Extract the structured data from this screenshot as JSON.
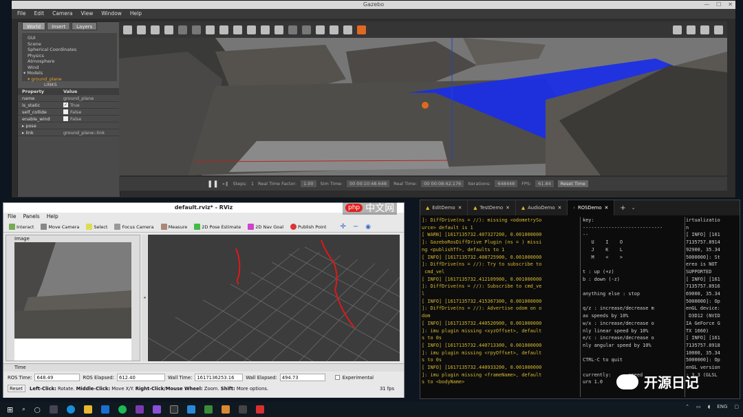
{
  "gazebo": {
    "title": "Gazebo",
    "menu": [
      "File",
      "Edit",
      "Camera",
      "View",
      "Window",
      "Help"
    ],
    "tabs": [
      "World",
      "Insert",
      "Layers"
    ],
    "tree": [
      "GUI",
      "Scene",
      "Spherical Coordinates",
      "Physics",
      "Atmosphere",
      "Wind",
      "▾ Models",
      "▾ ground_plane",
      "LINKS"
    ],
    "prop_header": {
      "property": "Property",
      "value": "Value"
    },
    "props": [
      {
        "k": "name",
        "v": "ground_plane"
      },
      {
        "k": "is_static",
        "v": "True",
        "checked": true
      },
      {
        "k": "self_collide",
        "v": "False",
        "checked": false
      },
      {
        "k": "enable_wind",
        "v": "False",
        "checked": false
      },
      {
        "k": "▸ pose",
        "v": ""
      },
      {
        "k": "▸ link",
        "v": "ground_plane::link"
      }
    ],
    "bottom": {
      "steps_label": "Steps:",
      "steps": "1",
      "rtf_label": "Real Time Factor:",
      "rtf": "1.00",
      "sim_label": "Sim Time:",
      "sim": "00 00:10:48.648",
      "real_label": "Real Time:",
      "real": "00 00:08:42.176",
      "iter_label": "Iterations:",
      "iter": "648448",
      "fps_label": "FPS:",
      "fps": "61.84",
      "reset": "Reset Time"
    }
  },
  "rviz": {
    "title": "default.rviz* - RViz",
    "menu": [
      "File",
      "Panels",
      "Help"
    ],
    "tools": [
      "Interact",
      "Move Camera",
      "Select",
      "Focus Camera",
      "Measure",
      "2D Pose Estimate",
      "2D Nav Goal",
      "Publish Point"
    ],
    "image_panel": "Image",
    "time_panel": "Time",
    "ros_time_label": "ROS Time:",
    "ros_time": "648.49",
    "ros_elapsed_label": "ROS Elapsed:",
    "ros_elapsed": "612.40",
    "wall_time_label": "Wall Time:",
    "wall_time": "1617136253.16",
    "wall_elapsed_label": "Wall Elapsed:",
    "wall_elapsed": "494.73",
    "experimental": "Experimental",
    "reset": "Reset",
    "hint_b1": "Left-Click:",
    "hint_t1": " Rotate. ",
    "hint_b2": "Middle-Click:",
    "hint_t2": " Move X/Y. ",
    "hint_b3": "Right-Click/Mouse Wheel:",
    "hint_t3": " Zoom. ",
    "hint_b4": "Shift:",
    "hint_t4": " More options.",
    "fps": "31 fps"
  },
  "terminal": {
    "tabs": [
      "EditDemo",
      "TestDemo",
      "AudioDemo",
      "ROSDemo"
    ],
    "pane1": "]: DiffDrive(ns = //): missing <odometrySo\nurce> default is 1\n[ WARN] [1617135732.407327200, 0.001000000\n]: GazeboRosDiffDrive Plugin (ns = ) missi\nng <publishTf>, defaults to 1\n[ INFO] [1617135732.408725900, 0.001000000\n]: DiffDrive(ns = //): Try to subscribe to\n cmd_vel\n[ INFO] [1617135732.412109900, 0.001000000\n]: DiffDrive(ns = //): Subscribe to cmd_ve\nl\n[ INFO] [1617135732.415367300, 0.001000000\n]: DiffDrive(ns = //): Advertise odom on o\ndom\n[ INFO] [1617135732.440520900, 0.001000000\n]: imu plugin missing <xyzOffset>, default\ns to 0s\n[ INFO] [1617135732.440713300, 0.001000000\n]: imu plugin missing <rpyOffset>, default\ns to 0s\n[ INFO] [1617135732.440933200, 0.001000000\n]: imu plugin missing <frameName>, default\ns to <bodyName>",
    "pane2": "key:\n----------------------------\n--\n   U    I    O\n   J    K    L\n   M    <    >\n\nt : up (+z)\nb : down (-z)\n\nanything else : stop\n\nq/z : increase/decrease m\nax speeds by 10%\nw/x : increase/decrease o\nnly linear speed by 10%\ne/c : increase/decrease o\nnly angular speed by 10%\n\nCTRL-C to quit\n\ncurrently:      speed\nurn 1.0",
    "pane3": "irtualizatio\nn\n[ INFO] [161\n7135757.8914\n92900, 35.34\n5000000]: St\nereo is NOT\nSUPPORTED\n[ INFO] [161\n7135757.8916\n69000, 35.34\n5000000]: Op\nenGL device:\n D3D12 (NVID\nIA GeForce G\nTX 1660)\n[ INFO] [161\n7135757.8918\n10000, 35.34\n5000000]: Op\nenGL version\n: 3.3 (GLSL\n"
  },
  "watermark": {
    "php": "中文网",
    "php_badge": "php",
    "site": "开源日记"
  },
  "tray": {
    "lang": "ENG"
  }
}
